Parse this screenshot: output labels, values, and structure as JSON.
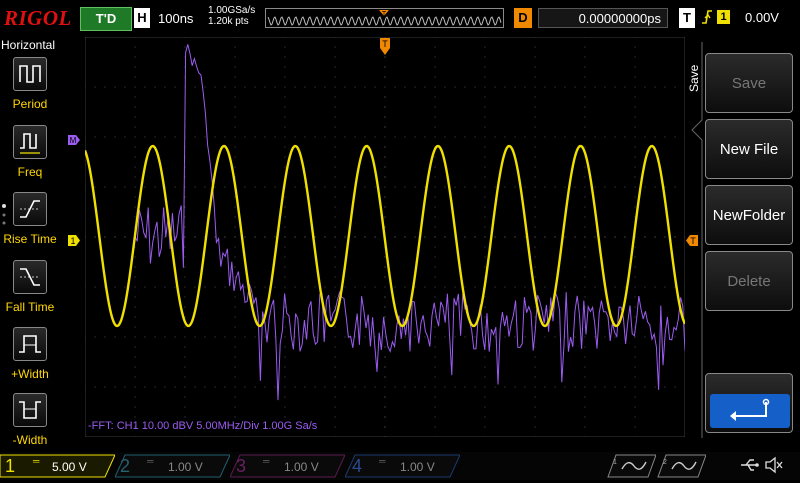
{
  "brand": "RIGOL",
  "topbar": {
    "run_status": "T'D",
    "horizontal_label": "H",
    "timebase": "100ns",
    "sample_rate": "1.00GSa/s",
    "memory_depth": "1.20k pts",
    "trigger_marker": "T",
    "delay_label": "D",
    "delay_value": "0.00000000ps",
    "trigger_label": "T",
    "trigger_edge_icon": "rising-edge-icon",
    "trigger_source": "1",
    "trigger_level": "0.00V"
  },
  "left_menu": {
    "title": "Horizontal",
    "items": [
      {
        "label": "Period",
        "icon": "period-measure-icon"
      },
      {
        "label": "Freq",
        "icon": "frequency-measure-icon"
      },
      {
        "label": "Rise Time",
        "icon": "rise-time-icon"
      },
      {
        "label": "Fall Time",
        "icon": "fall-time-icon"
      },
      {
        "label": "+Width",
        "icon": "positive-width-icon"
      },
      {
        "label": "-Width",
        "icon": "negative-width-icon"
      }
    ]
  },
  "right_menu": {
    "title": "Save",
    "items": [
      {
        "label": "Save",
        "enabled": false
      },
      {
        "label": "New File",
        "enabled": true
      },
      {
        "label": "NewFolder",
        "enabled": true
      },
      {
        "label": "Delete",
        "enabled": false
      }
    ],
    "enter_icon": "enter-return-icon"
  },
  "screen": {
    "math_marker": "M",
    "ch1_marker": "1",
    "trig_level_marker": "T",
    "fft_info": "-FFT:  CH1  10.00 dBV    5.00MHz/Div    1.00G Sa/s"
  },
  "channels": [
    {
      "num": "1",
      "scale": "5.00 V",
      "color": "#f0e000",
      "active": true
    },
    {
      "num": "2",
      "scale": "1.00 V",
      "color": "#2ab0d8",
      "active": false
    },
    {
      "num": "3",
      "scale": "1.00 V",
      "color": "#e020c0",
      "active": false
    },
    {
      "num": "4",
      "scale": "1.00 V",
      "color": "#2a60e0",
      "active": false
    }
  ],
  "colors": {
    "ch1": "#f0e000",
    "math": "#9b5cf0",
    "trigger": "#f08800",
    "brand": "#e01010"
  },
  "status_icons": [
    "waveform-gen-1-icon",
    "waveform-gen-2-icon",
    "usb-icon",
    "speaker-mute-icon"
  ]
}
